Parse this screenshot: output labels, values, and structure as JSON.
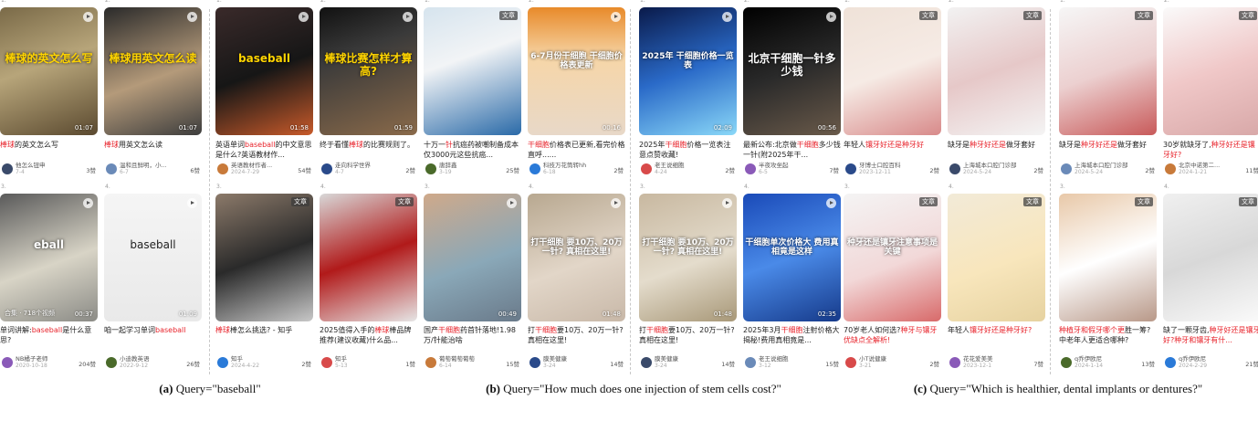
{
  "figure": {
    "like_suffix": "赞",
    "panels": [
      {
        "caption_label": "(a)",
        "caption_text": "Query=\"baseball\"",
        "columns": [
          [
            {
              "rank": "1.",
              "type": "video",
              "duration": "01:07",
              "overlay": "棒球的英文怎么写",
              "title": [
                "棒球",
                "的英文怎么写"
              ],
              "author": "他怎么钮申",
              "date": "7-4",
              "likes": "3"
            },
            {
              "rank": "3.",
              "type": "video",
              "duration": "00:37",
              "overlay": "eball",
              "extra": "合集 · 718个视频",
              "title": [
                "单词讲解:",
                "baseball",
                "是什么意思?"
              ],
              "author": "NB橘子老师",
              "date": "2020-10-18",
              "likes": "204"
            }
          ],
          [
            {
              "rank": "2.",
              "type": "video",
              "duration": "01:07",
              "overlay": "棒球用英文怎么读",
              "title": [
                "棒球",
                "用英文怎么读"
              ],
              "author": "温和且鲜明，小...",
              "date": "6-7",
              "likes": "6"
            },
            {
              "rank": "4.",
              "type": "video",
              "duration": "01:09",
              "overlay": "baseball",
              "title": [
                "咱一起学习单词",
                "baseball"
              ],
              "author": "小迪教英语",
              "date": "2022-9-12",
              "likes": "26"
            }
          ],
          [
            {
              "rank": "1.",
              "type": "video",
              "duration": "01:58",
              "overlay": "baseball",
              "title": [
                "英语单词",
                "baseball",
                "的中文意思是什么?英语教材作..."
              ],
              "author": "英语教材作者...",
              "date": "2024-7-29",
              "likes": "54"
            },
            {
              "rank": "3.",
              "type": "article",
              "tag": "文章",
              "title": [
                "棒球",
                "棒怎么挑选? - 知乎"
              ],
              "author": "知乎",
              "date": "2024-4-22",
              "likes": "2"
            }
          ],
          [
            {
              "rank": "2.",
              "type": "video",
              "duration": "01:59",
              "overlay": "棒球比赛怎样才算高?",
              "title": [
                "终于看懂",
                "棒球",
                "的比赛规则了。"
              ],
              "author": "走向科学世界",
              "date": "4-7",
              "likes": "2"
            },
            {
              "rank": "4.",
              "type": "article",
              "tag": "文章",
              "title": [
                "2025值得入手的",
                "棒球",
                "棒品牌推荐(建议收藏)什么品..."
              ],
              "author": "知乎",
              "date": "5-13",
              "likes": "1"
            }
          ]
        ]
      },
      {
        "caption_label": "(b)",
        "caption_text": "Query=\"How much does one injection of stem cells cost?\"",
        "columns": [
          [
            {
              "rank": "1.",
              "type": "article",
              "tag": "文章",
              "title": [
                "十万一",
                "针",
                "抗癌药被嘲制备成本仅3000元这些抗癌..."
              ],
              "author": "唐辞鑫",
              "date": "3-19",
              "likes": "25"
            },
            {
              "rank": "3.",
              "type": "video",
              "duration": "00:49",
              "overlay": "",
              "title": [
                "国产",
                "干细胞",
                "药首针落地!1.98万/针能治啥"
              ],
              "author": "葡萄葡萄葡萄",
              "date": "6-14",
              "likes": "15"
            }
          ],
          [
            {
              "rank": "2.",
              "type": "video",
              "duration": "00:16",
              "overlay": "6-7月份干细胞 干细胞价格表更新",
              "title": [
                "干细胞",
                "价格表已更新,看完价格直呼......"
              ],
              "author": "科技万花筒转hh",
              "date": "6-18",
              "likes": "2"
            },
            {
              "rank": "4.",
              "type": "video",
              "duration": "01:48",
              "overlay": "打干细胞 要10万、20万一针? 真相在这里!",
              "title": [
                "打",
                "干细胞",
                "要10万、20万一针?真相在这里!"
              ],
              "author": "膜美健康",
              "date": "3-24",
              "likes": "14"
            }
          ],
          [
            {
              "rank": "1.",
              "type": "video",
              "duration": "02:09",
              "overlay": "2025年 干细胞价格一览表",
              "title": [
                "2025年",
                "干细胞",
                "价格一览表注意点赞收藏!"
              ],
              "author": "老王说细胞",
              "date": "4-24",
              "likes": "2"
            },
            {
              "rank": "3.",
              "type": "video",
              "duration": "01:48",
              "overlay": "打干细胞 要10万、20万一针? 真相在这里!",
              "title": [
                "打",
                "干细胞",
                "要10万、20万一针?真相在这里!"
              ],
              "author": "膜美健康",
              "date": "3-24",
              "likes": "14"
            }
          ],
          [
            {
              "rank": "2.",
              "type": "video",
              "duration": "00:56",
              "overlay": "北京干细胞一针多少钱",
              "title": [
                "最新公布:北京做",
                "干细胞",
                "多少钱一针(附2025年干..."
              ],
              "author": "半夜攻坐起",
              "date": "6-5",
              "likes": "7"
            },
            {
              "rank": "4.",
              "type": "video",
              "duration": "02:35",
              "overlay": "干细胞单次价格大 费用真相竟是这样",
              "title": [
                "2025年3月",
                "干细胞",
                "注射价格大揭秘!费用真相竟是..."
              ],
              "author": "老王说细胞",
              "date": "3-12",
              "likes": "15"
            }
          ]
        ]
      },
      {
        "caption_label": "(c)",
        "caption_text": "Query=\"Which is healthier, dental implants or dentures?\"",
        "columns": [
          [
            {
              "rank": "1.",
              "type": "article",
              "tag": "文章",
              "title": [
                "年轻人",
                "镶牙好还是种牙好"
              ],
              "author": "牙博士口腔百科",
              "date": "2023-12-11",
              "likes": "2"
            },
            {
              "rank": "3.",
              "type": "article",
              "tag": "文章",
              "overlay": "种牙还是镶牙注意事项是关键",
              "title": [
                "70岁老人如何选?",
                "种牙",
                "与镶牙优缺点全解析!"
              ],
              "author": "小T说健康",
              "date": "3-21",
              "likes": "2"
            }
          ],
          [
            {
              "rank": "2.",
              "type": "article",
              "tag": "文章",
              "title": [
                "缺牙是",
                "种牙好还是",
                "做牙套好"
              ],
              "author": "上海城本口腔门诊部",
              "date": "2024-5-24",
              "likes": "2"
            },
            {
              "rank": "4.",
              "type": "article",
              "tag": "文章",
              "title": [
                "年轻人",
                "镶牙好还是种牙好?"
              ],
              "author": "花花爱美美",
              "date": "2023-12-1",
              "likes": "7"
            }
          ],
          [
            {
              "rank": "1.",
              "type": "article",
              "tag": "文章",
              "title": [
                "缺牙是",
                "种牙好还是",
                "做牙套好"
              ],
              "author": "上海城本口腔门诊部",
              "date": "2024-5-24",
              "likes": "2"
            },
            {
              "rank": "3.",
              "type": "article",
              "tag": "文章",
              "title": [
                "种植牙",
                "和假牙",
                "哪个更",
                "胜一筹?中老年人更适合哪种?"
              ],
              "author": "q乔伊欧尼",
              "date": "2024-1-14",
              "likes": "13"
            }
          ],
          [
            {
              "rank": "2.",
              "type": "article",
              "tag": "文章",
              "title": [
                "30岁就缺牙了,",
                "种牙好还是镶牙好?"
              ],
              "author": "北京中诺第二...",
              "date": "2024-1-21",
              "likes": "11"
            },
            {
              "rank": "4.",
              "type": "article",
              "tag": "文章",
              "title": [
                "缺了一颗牙齿,",
                "种牙好还是镶牙好?",
                "种牙和镶牙有什..."
              ],
              "author": "q乔伊欧尼",
              "date": "2024-2-29",
              "likes": "21"
            }
          ]
        ]
      }
    ],
    "colors": {
      "highlight": "#e8242c",
      "text": "#222222",
      "meta": "#555555",
      "muted": "#aaaaaa"
    }
  }
}
